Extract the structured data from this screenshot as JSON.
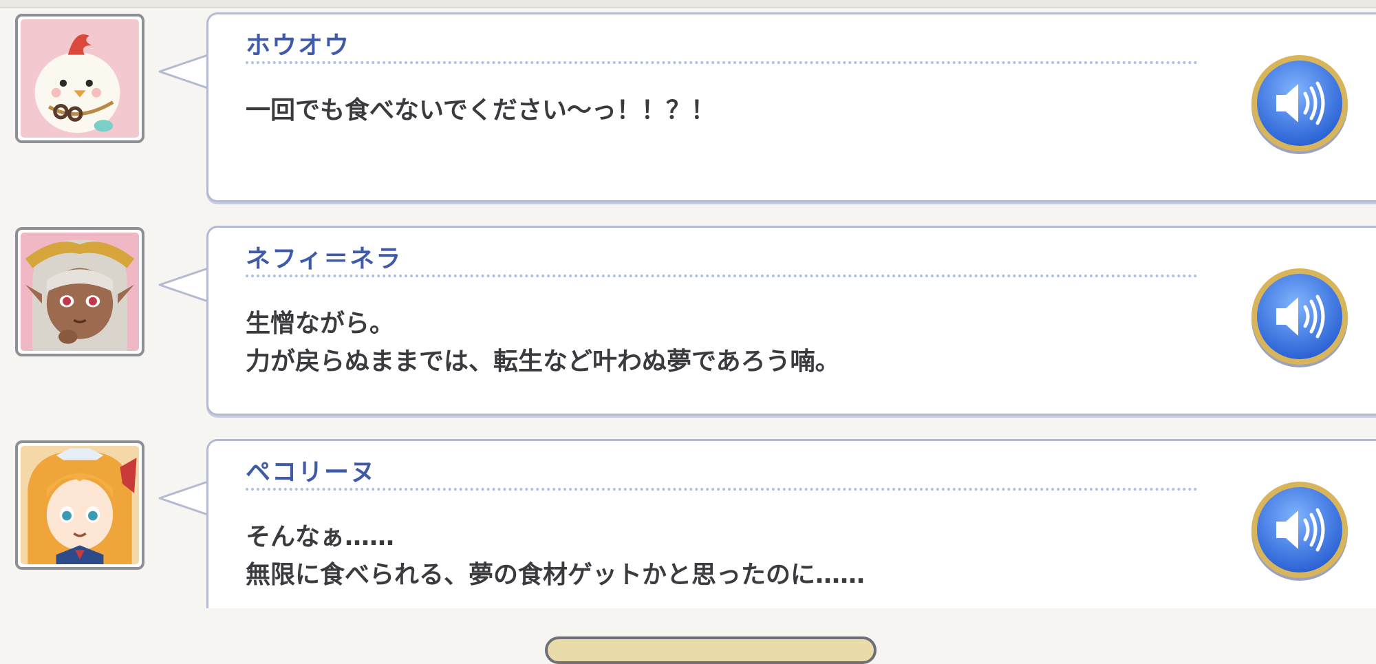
{
  "log_entries": [
    {
      "speaker": "ホウオウ",
      "lines": [
        "一回でも食べないでください〜っ！！？！"
      ],
      "avatar_icon": "white-bird-character-icon",
      "voice_icon": "speaker-volume-icon"
    },
    {
      "speaker": "ネフィ＝ネラ",
      "lines": [
        "生憎ながら。",
        "力が戻らぬままでは、転生など叶わぬ夢であろう喃。"
      ],
      "avatar_icon": "silver-haired-character-icon",
      "voice_icon": "speaker-volume-icon"
    },
    {
      "speaker": "ペコリーヌ",
      "lines": [
        "そんなぁ……",
        "無限に食べられる、夢の食材ゲットかと思ったのに……"
      ],
      "avatar_icon": "orange-haired-character-icon",
      "voice_icon": "speaker-volume-icon"
    }
  ],
  "colors": {
    "name_text": "#3e5aa8",
    "dialogue_text": "#3a3a3f",
    "voice_button": "#3f7fe0",
    "voice_button_rim": "#d8b45a",
    "background": "#f6f5f1"
  }
}
